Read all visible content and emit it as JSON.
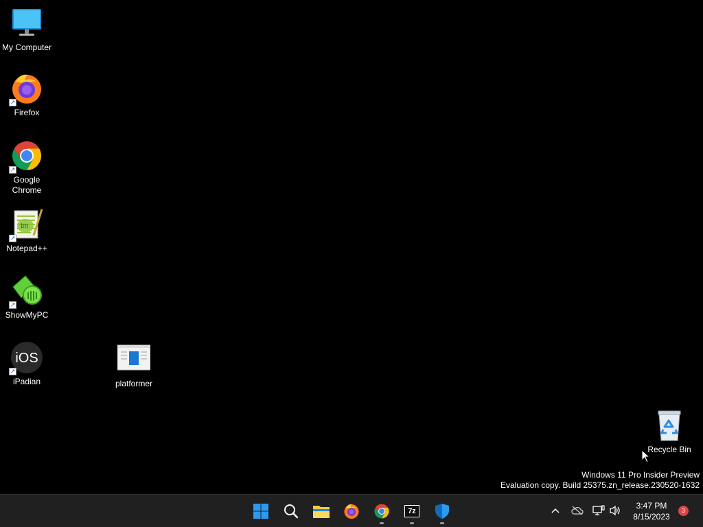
{
  "desktop": {
    "icons": [
      {
        "label": "My Computer",
        "icon": "monitor-icon"
      },
      {
        "label": "Firefox",
        "icon": "firefox-icon"
      },
      {
        "label": "Google Chrome",
        "icon": "chrome-icon"
      },
      {
        "label": "Notepad++",
        "icon": "notepadpp-icon"
      },
      {
        "label": "ShowMyPC",
        "icon": "showmypc-icon"
      },
      {
        "label": "iPadian",
        "icon": "ipadian-icon"
      },
      {
        "label": "platformer",
        "icon": "html-file-icon"
      },
      {
        "label": "Recycle Bin",
        "icon": "recycle-bin-icon"
      }
    ],
    "ipadian_text": "iOS",
    "notepad_text": "tm"
  },
  "watermark": {
    "line1": "Windows 11 Pro Insider Preview",
    "line2": "Evaluation copy. Build 25375.zn_release.230520-1632"
  },
  "taskbar": {
    "apps": [
      "start-icon",
      "search-icon",
      "file-explorer-icon",
      "firefox-icon",
      "chrome-icon",
      "7zip-icon",
      "defender-icon"
    ],
    "seven_zip_text": "7z",
    "tray": {
      "time": "3:47 PM",
      "date": "8/15/2023",
      "notification_count": "3"
    }
  },
  "colors": {
    "taskbar_bg": "#202020",
    "desktop_bg": "#000000",
    "start_blue": "#2b9af3",
    "badge_red": "#e04343"
  }
}
